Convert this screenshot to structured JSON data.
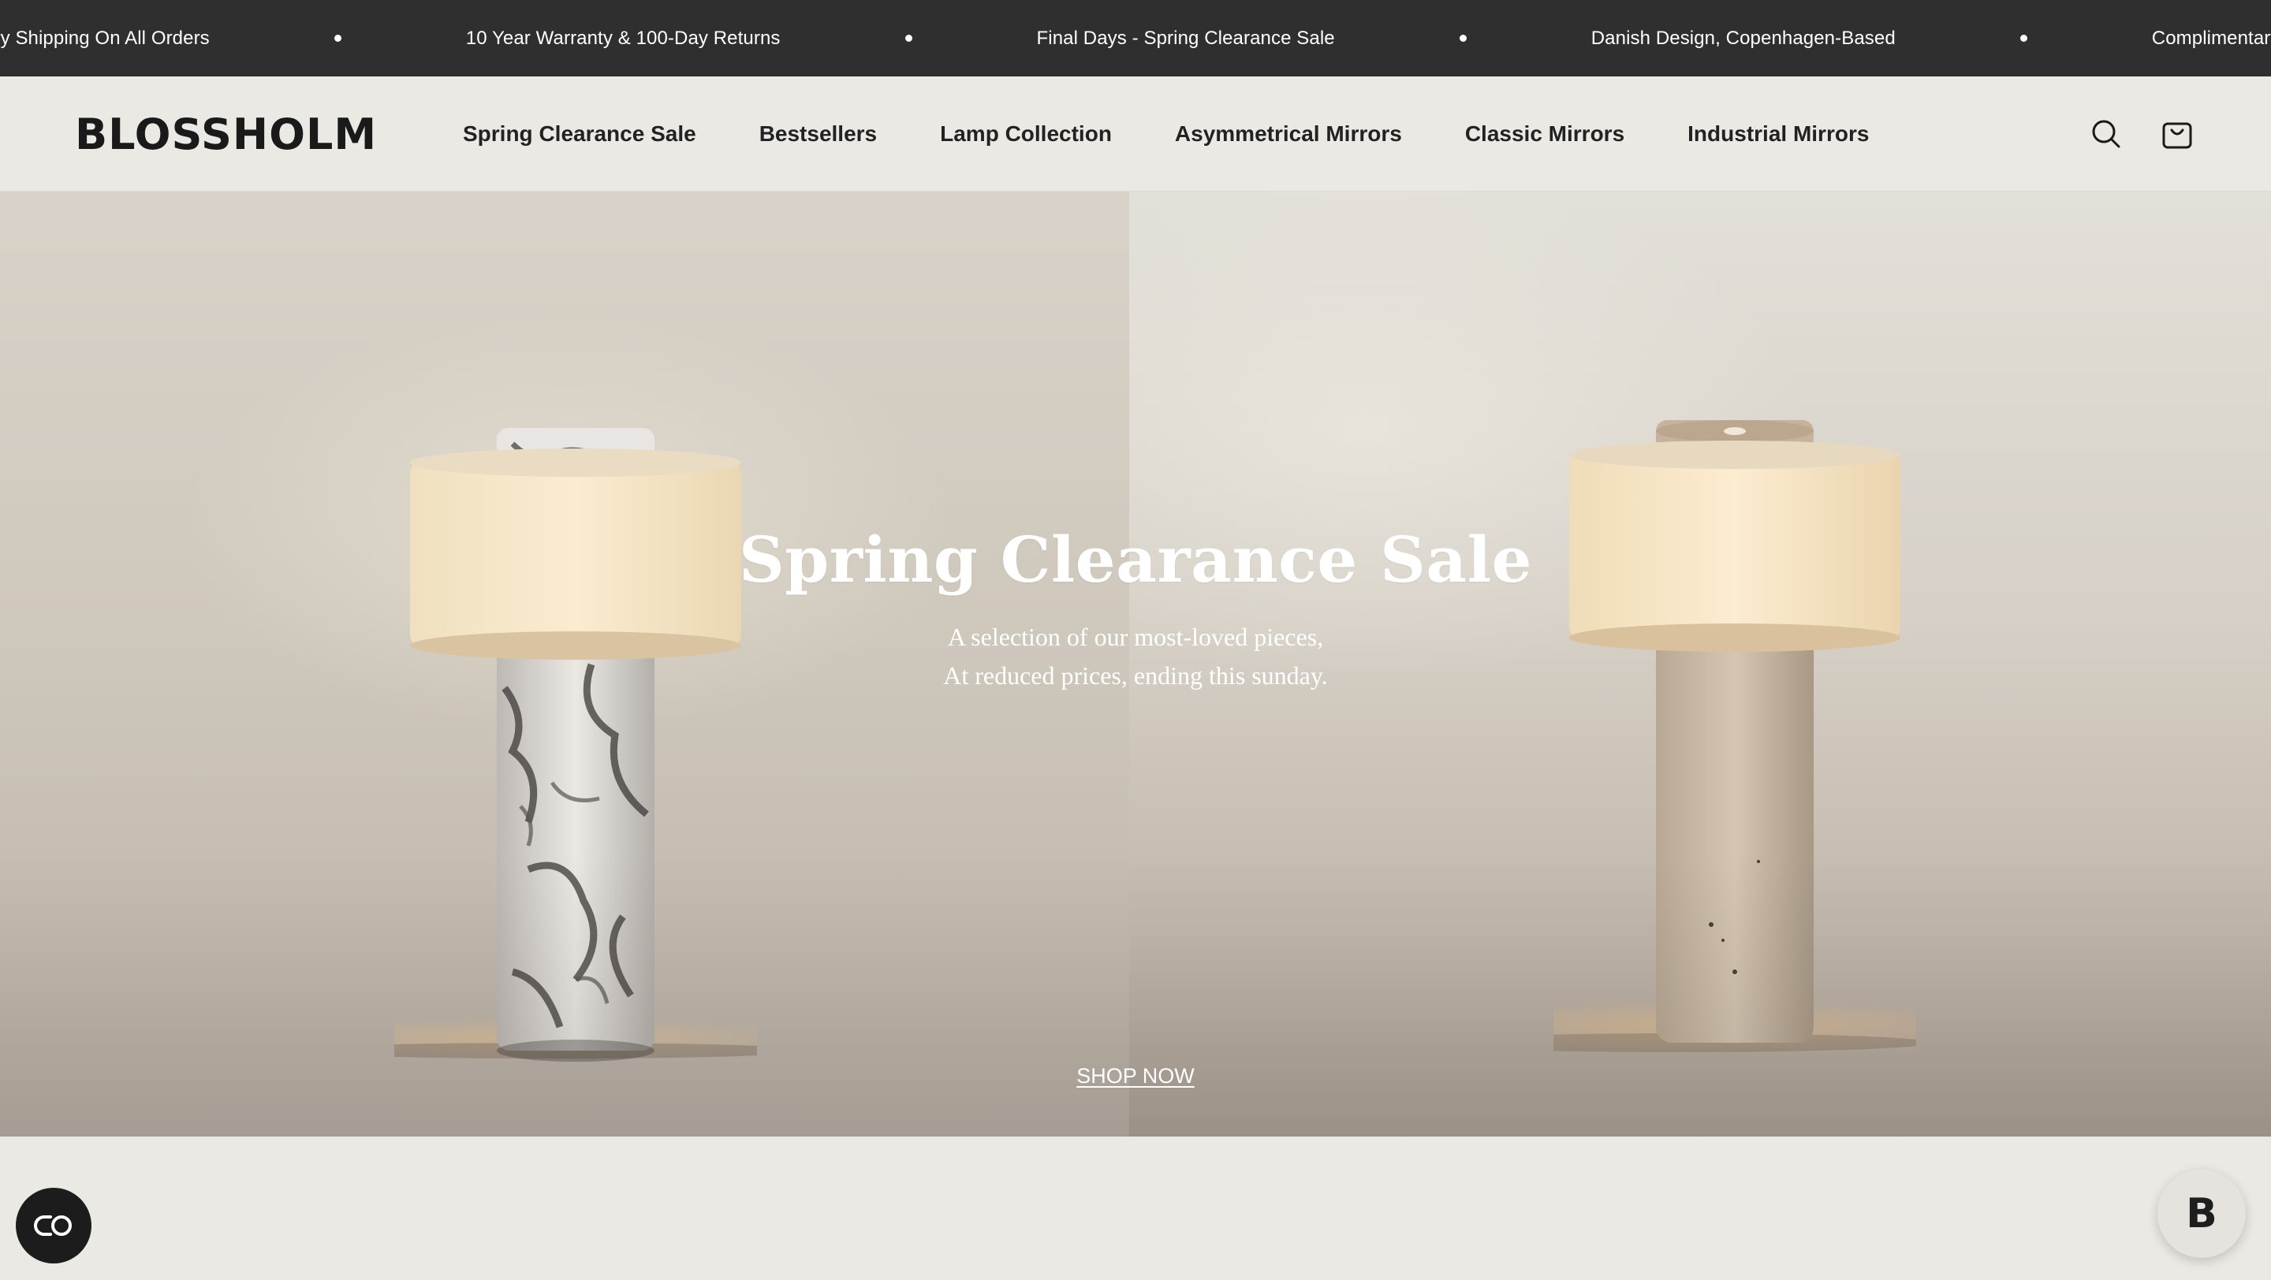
{
  "announcement": {
    "items": [
      "Complimentary Shipping On All Orders",
      "10 Year Warranty & 100-Day Returns",
      "Final Days - Spring Clearance Sale",
      "Danish Design, Copenhagen-Based",
      "Complimentary Shipping On All Orders"
    ]
  },
  "header": {
    "logo": "BLOSSHOLM",
    "nav": [
      "Spring Clearance Sale",
      "Bestsellers",
      "Lamp Collection",
      "Asymmetrical Mirrors",
      "Classic Mirrors",
      "Industrial Mirrors"
    ],
    "icons": [
      "search-icon",
      "bag-icon"
    ]
  },
  "hero": {
    "title": "Spring Clearance Sale",
    "subtitle_line1": "A selection of our most-loved pieces,",
    "subtitle_line2": "At reduced prices, ending this sunday.",
    "cta": "SHOP NOW"
  },
  "widgets": {
    "left_fab_icon": "accessibility-icon",
    "right_fab_label": "B"
  },
  "colors": {
    "announcement_bg": "#2f2f2f",
    "page_bg": "#eae9e4",
    "text_dark": "#222222",
    "hero_text": "#ffffff"
  }
}
